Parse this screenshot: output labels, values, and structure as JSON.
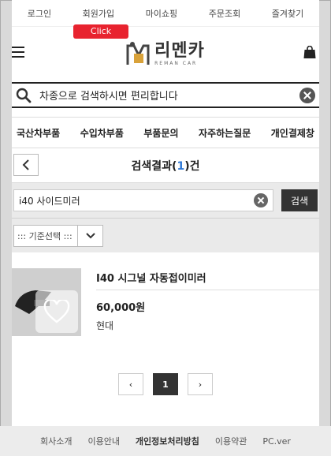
{
  "topbar": {
    "links": [
      "로그인",
      "회원가입",
      "마이쇼핑",
      "주문조회",
      "즐겨찾기"
    ],
    "click_badge": "Click"
  },
  "header": {
    "logo_text": "리멘카",
    "logo_sub": "REMAN CAR"
  },
  "search": {
    "placeholder": "차종으로 검색하시면 편리합니다"
  },
  "nav": {
    "items": [
      "국산차부품",
      "수입차부품",
      "부품문의",
      "자주하는질문",
      "개인결제창"
    ]
  },
  "result": {
    "title_prefix": "검색결과(",
    "count": "1",
    "title_suffix": ")건"
  },
  "refine": {
    "value": "i40 사이드미러",
    "button": "검색"
  },
  "sort": {
    "selected": "::: 기준선택 :::"
  },
  "products": [
    {
      "name": "I40 시그널 자동접이미러",
      "price": "60,000원",
      "brand": "현대"
    }
  ],
  "pagination": {
    "prev": "‹",
    "current": "1",
    "next": "›"
  },
  "footer": {
    "links": [
      "회사소개",
      "이용안내",
      "개인정보처리방침",
      "이용약관",
      "PC.ver"
    ]
  }
}
